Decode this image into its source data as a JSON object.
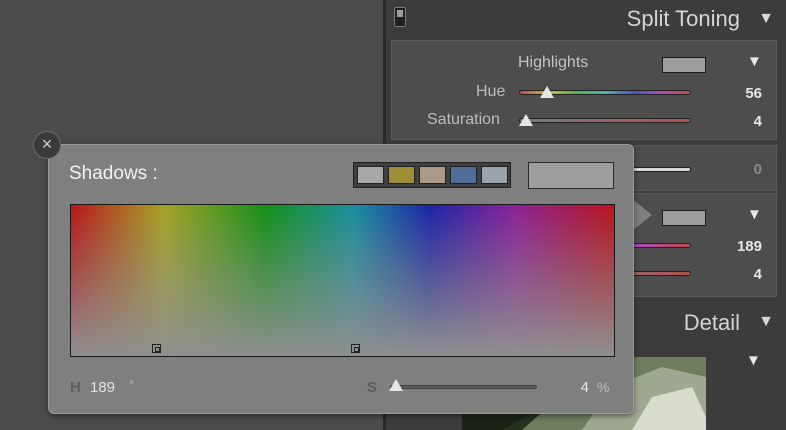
{
  "split_toning": {
    "title": "Split Toning",
    "highlights": {
      "label": "Highlights",
      "hue_label": "Hue",
      "hue_value": "56",
      "hue_slider": 0.16,
      "saturation_label": "Saturation",
      "saturation_value": "4",
      "saturation_slider": 0.04,
      "swatch_color": "#9d9d9d"
    },
    "balance_value": "0",
    "shadows": {
      "hue_value": "189",
      "saturation_value": "4",
      "swatch_color": "#9d9d9d"
    }
  },
  "detail": {
    "title": "Detail"
  },
  "popup": {
    "title": "Shadows :",
    "close_icon": "×",
    "presets": [
      "#a9a9a9",
      "#9f8e38",
      "#ab9a87",
      "#4e6e9a",
      "#9ba3ab"
    ],
    "current_color": "#9e9e9e",
    "hue_letter": "H",
    "hue_value": "189",
    "hue_unit": "°",
    "saturation_letter": "S",
    "saturation_value": "4",
    "saturation_unit": "%",
    "saturation_fraction": 0.04
  },
  "icons": {
    "collapse": "▼",
    "panel_switch": "panel-switch-icon"
  }
}
